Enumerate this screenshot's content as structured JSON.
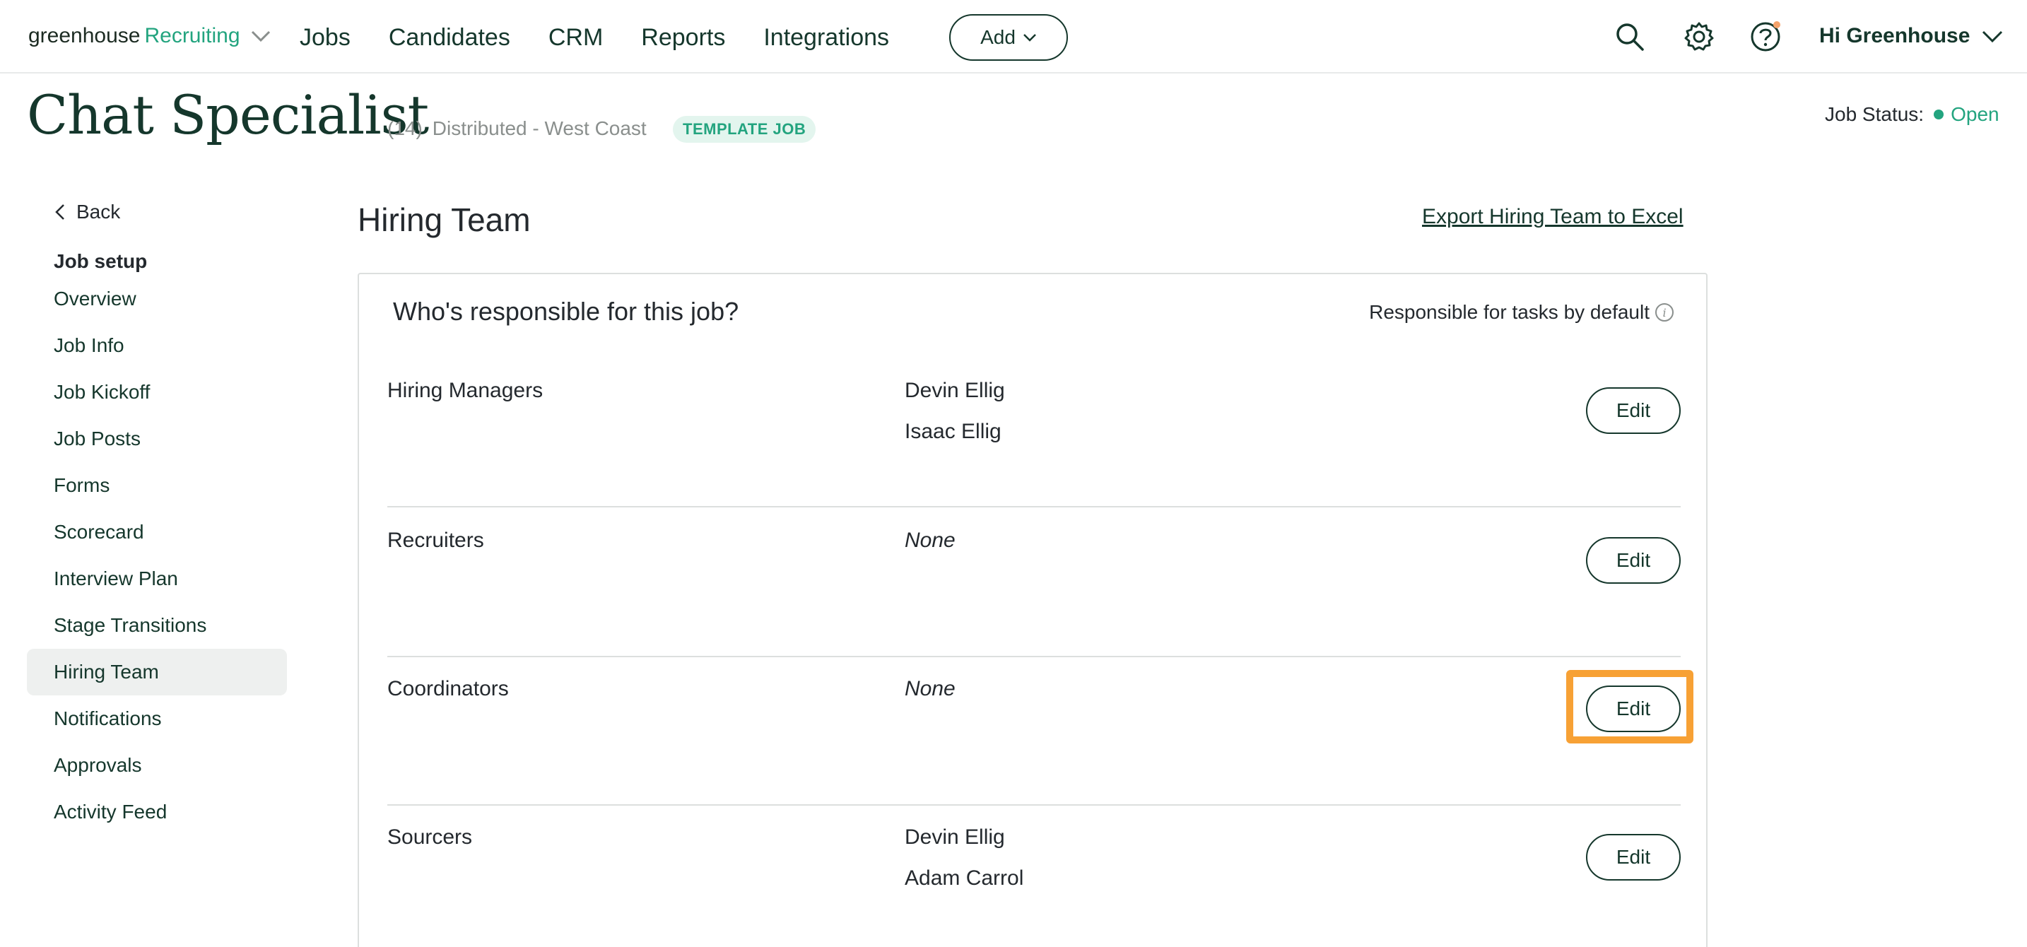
{
  "nav": {
    "brand_primary": "greenhouse",
    "brand_secondary": "Recruiting",
    "links": [
      "Jobs",
      "Candidates",
      "CRM",
      "Reports",
      "Integrations"
    ],
    "add_label": "Add",
    "user_greeting": "Hi Greenhouse"
  },
  "job": {
    "title": "Chat Specialist",
    "count": "(14)",
    "location": "Distributed - West Coast",
    "badge": "TEMPLATE JOB",
    "status_label": "Job Status:",
    "status_value": "Open"
  },
  "sidebar": {
    "back": "Back",
    "heading": "Job setup",
    "items": [
      "Overview",
      "Job Info",
      "Job Kickoff",
      "Job Posts",
      "Forms",
      "Scorecard",
      "Interview Plan",
      "Stage Transitions",
      "Hiring Team",
      "Notifications",
      "Approvals",
      "Activity Feed"
    ],
    "active": "Hiring Team"
  },
  "main": {
    "section_title": "Hiring Team",
    "export_link": "Export Hiring Team to Excel",
    "card_question": "Who's responsible for this job?",
    "responsible_label": "Responsible for tasks by default",
    "edit_label": "Edit",
    "rows": [
      {
        "role": "Hiring Managers",
        "members": [
          "Devin Ellig",
          "Isaac Ellig"
        ]
      },
      {
        "role": "Recruiters",
        "members": [
          "None"
        ]
      },
      {
        "role": "Coordinators",
        "members": [
          "None"
        ]
      },
      {
        "role": "Sourcers",
        "members": [
          "Devin Ellig",
          "Adam Carrol"
        ]
      }
    ]
  },
  "colors": {
    "brand_green": "#23a47f",
    "dark_green": "#15372c",
    "highlight": "#f7a135"
  }
}
